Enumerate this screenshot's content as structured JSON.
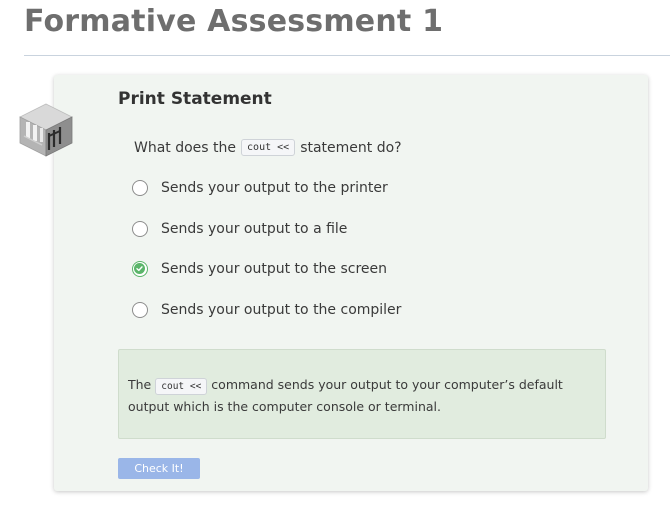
{
  "page": {
    "title": "Formative Assessment 1"
  },
  "question": {
    "title": "Print Statement",
    "prompt_prefix": "What does the",
    "prompt_code": "cout <<",
    "prompt_suffix": "statement do?",
    "icon": "assessment-cube-icon"
  },
  "options": [
    {
      "label": "Sends your output to the printer",
      "selected": false
    },
    {
      "label": "Sends your output to a file",
      "selected": false
    },
    {
      "label": "Sends your output to the screen",
      "selected": true
    },
    {
      "label": "Sends your output to the compiler",
      "selected": false
    }
  ],
  "feedback": {
    "prefix": "The",
    "code": "cout <<",
    "suffix": "command sends your output to your computer’s default output which is the computer console or terminal."
  },
  "actions": {
    "check_label": "Check It!"
  },
  "colors": {
    "card_bg": "#f1f5f1",
    "feedback_bg": "#e1ecdf",
    "selected_green": "#5bb56a",
    "button_blue": "#9ab6e8"
  }
}
